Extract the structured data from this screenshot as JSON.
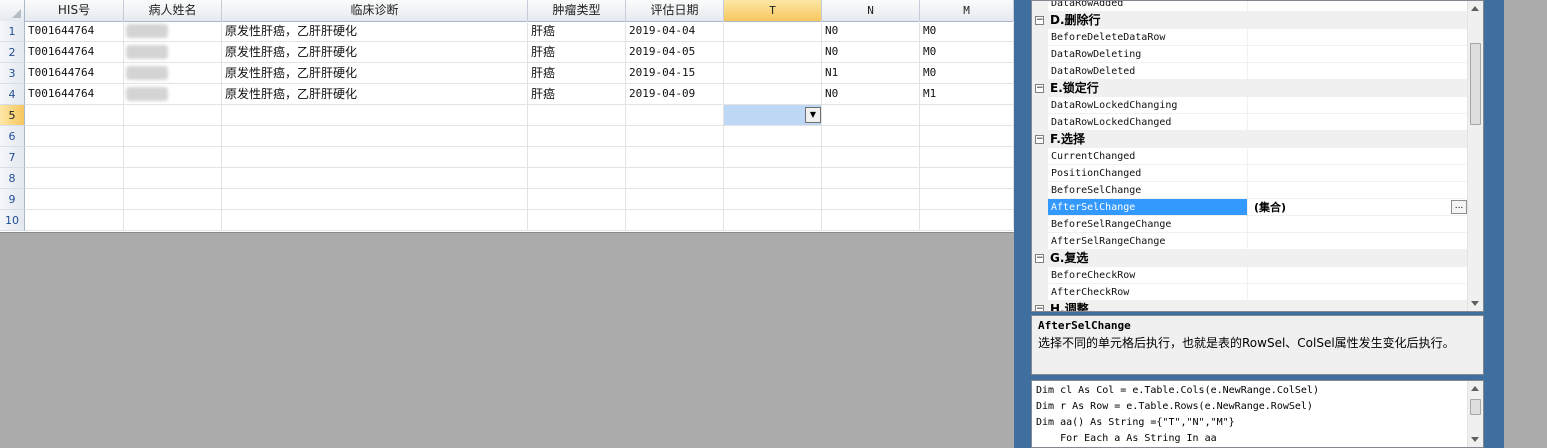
{
  "grid": {
    "columns": [
      "HIS号",
      "病人姓名",
      "临床诊断",
      "肿瘤类型",
      "评估日期",
      "T",
      "N",
      "M"
    ],
    "row_numbers": [
      "1",
      "2",
      "3",
      "4",
      "5",
      "6",
      "7",
      "8",
      "9",
      "10"
    ],
    "rows": [
      [
        "T001644764",
        "",
        "原发性肝癌，乙肝肝硬化",
        "肝癌",
        "2019-04-04",
        "",
        "N0",
        "M0"
      ],
      [
        "T001644764",
        "",
        "原发性肝癌，乙肝肝硬化",
        "肝癌",
        "2019-04-05",
        "",
        "N0",
        "M0"
      ],
      [
        "T001644764",
        "",
        "原发性肝癌，乙肝肝硬化",
        "肝癌",
        "2019-04-15",
        "",
        "N1",
        "M0"
      ],
      [
        "T001644764",
        "",
        "原发性肝癌，乙肝肝硬化",
        "肝癌",
        "2019-04-09",
        "",
        "N0",
        "M1"
      ]
    ],
    "active_column": "T",
    "active_row": "5",
    "dropdown_glyph": "▼"
  },
  "property_grid": {
    "items": [
      {
        "kind": "prop",
        "name": "DataRowAdded"
      },
      {
        "kind": "cat",
        "name": "D.删除行"
      },
      {
        "kind": "prop",
        "name": "BeforeDeleteDataRow"
      },
      {
        "kind": "prop",
        "name": "DataRowDeleting"
      },
      {
        "kind": "prop",
        "name": "DataRowDeleted"
      },
      {
        "kind": "cat",
        "name": "E.锁定行"
      },
      {
        "kind": "prop",
        "name": "DataRowLockedChanging"
      },
      {
        "kind": "prop",
        "name": "DataRowLockedChanged"
      },
      {
        "kind": "cat",
        "name": "F.选择"
      },
      {
        "kind": "prop",
        "name": "CurrentChanged"
      },
      {
        "kind": "prop",
        "name": "PositionChanged"
      },
      {
        "kind": "prop",
        "name": "BeforeSelChange"
      },
      {
        "kind": "prop",
        "name": "AfterSelChange",
        "value": "(集合)",
        "selected": true
      },
      {
        "kind": "prop",
        "name": "BeforeSelRangeChange"
      },
      {
        "kind": "prop",
        "name": "AfterSelRangeChange"
      },
      {
        "kind": "cat",
        "name": "G.复选"
      },
      {
        "kind": "prop",
        "name": "BeforeCheckRow"
      },
      {
        "kind": "prop",
        "name": "AfterCheckRow"
      },
      {
        "kind": "cat",
        "name": "H.调整"
      }
    ],
    "collapse_glyph": "−",
    "ellipsis_label": "..."
  },
  "description": {
    "title": "AfterSelChange",
    "text": "选择不同的单元格后执行，也就是表的RowSel、ColSel属性发生变化后执行。"
  },
  "code": {
    "lines": [
      "Dim cl As Col = e.Table.Cols(e.NewRange.ColSel)",
      "Dim r As Row = e.Table.Rows(e.NewRange.RowSel)",
      "Dim aa() As String ={\"T\",\"N\",\"M\"}",
      "    For Each a As String In aa"
    ]
  },
  "colors": {
    "panel_bg": "#3f6f9e",
    "selection": "#3399ff",
    "active_header": "#f7c75e",
    "selected_cell": "#bdd7f5"
  }
}
